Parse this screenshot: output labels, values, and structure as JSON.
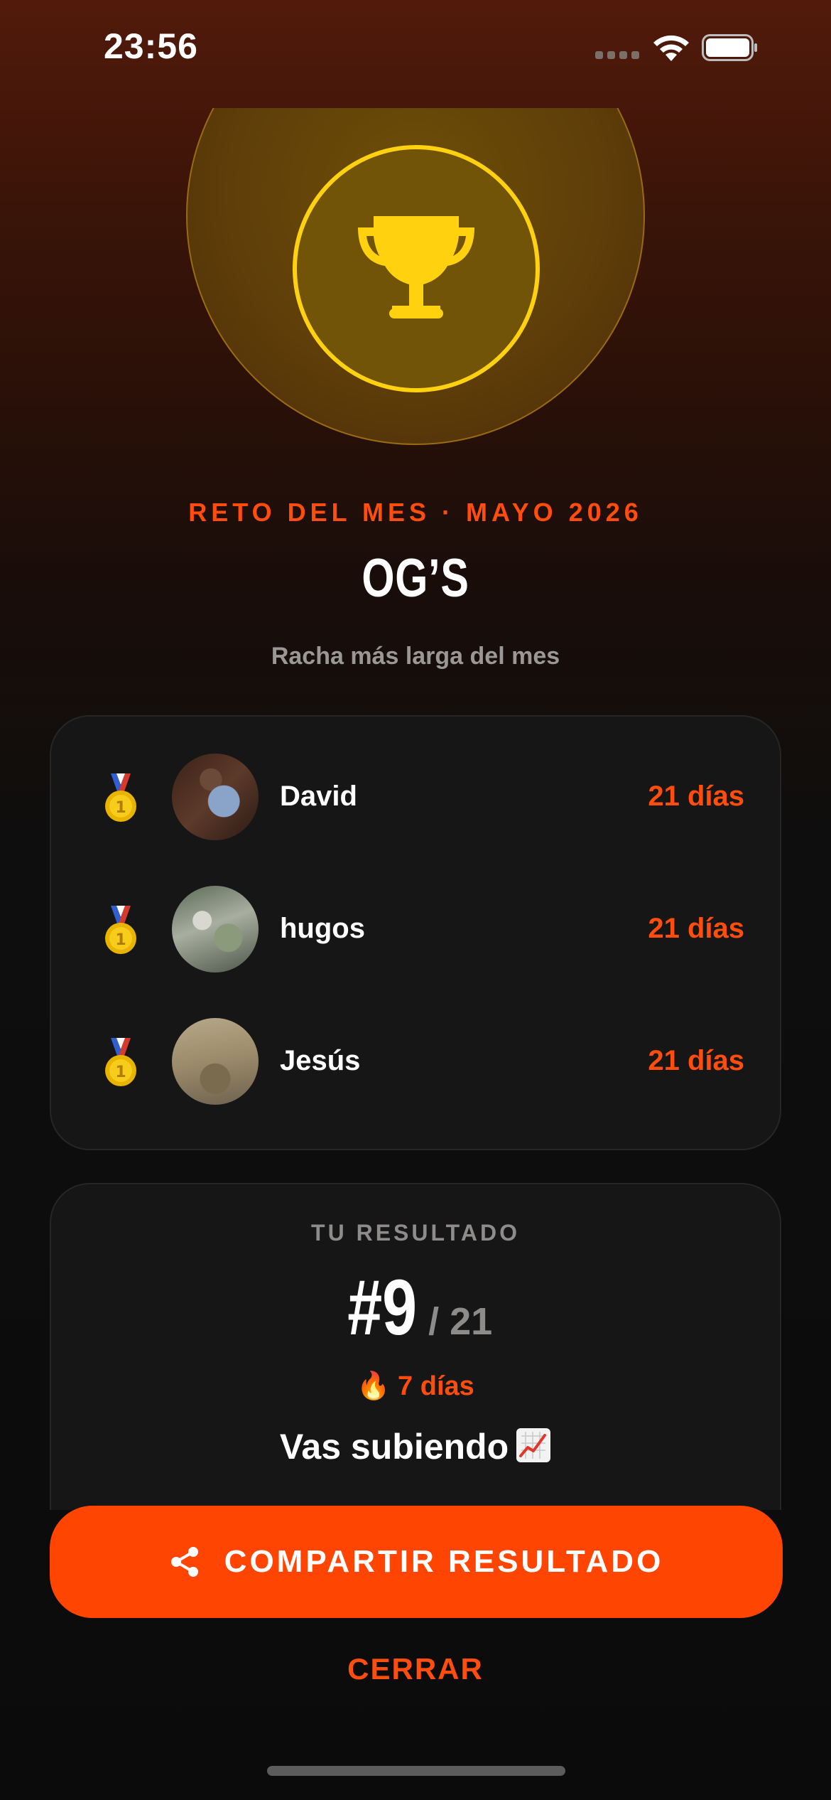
{
  "status_bar": {
    "time": "23:56",
    "signal_icon": "signal-dots-icon",
    "wifi_icon": "wifi-icon",
    "battery_icon": "battery-icon"
  },
  "hero": {
    "icon": "trophy-icon",
    "accent": "#ffd10f"
  },
  "challenge": {
    "eyebrow": "RETO DEL MES · MAYO 2026",
    "group_name": "OG’S",
    "subtitle": "Racha más larga del mes"
  },
  "leaderboard": [
    {
      "medal": "gold-medal-icon",
      "name": "David",
      "days": "21 días"
    },
    {
      "medal": "gold-medal-icon",
      "name": "hugos",
      "days": "21 días"
    },
    {
      "medal": "gold-medal-icon",
      "name": "Jesús",
      "days": "21 días"
    }
  ],
  "result": {
    "label": "TU RESULTADO",
    "rank": "#9",
    "total": "/ 21",
    "streak": "🔥 7 días",
    "status": "Vas subiendo",
    "status_icon": "chart-increasing-icon"
  },
  "actions": {
    "share_label": "COMPARTIR RESULTADO",
    "share_icon": "share-icon",
    "close_label": "CERRAR"
  },
  "colors": {
    "accent": "#ff4d0d",
    "button": "#ff4501",
    "card": "#161616",
    "muted": "#8e8b8b"
  }
}
